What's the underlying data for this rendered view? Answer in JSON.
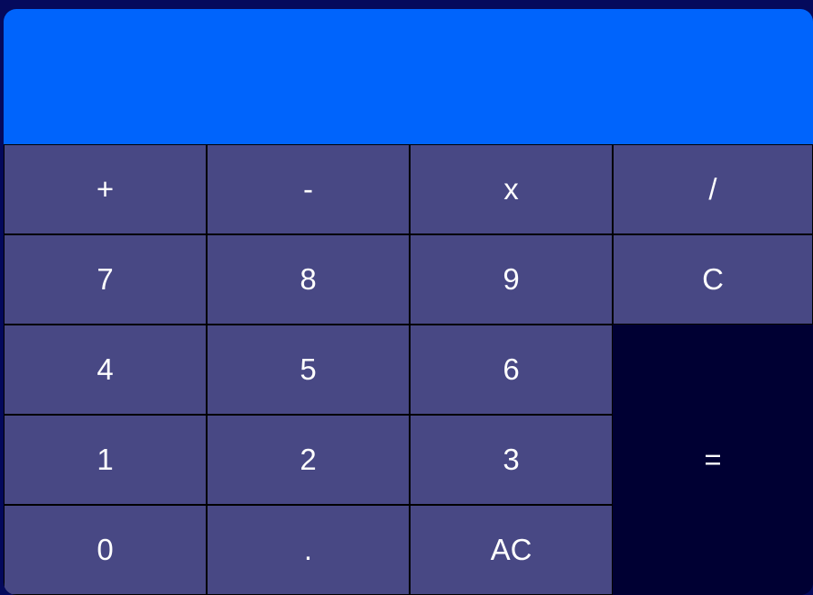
{
  "display": {
    "value": ""
  },
  "keys": {
    "plus": "+",
    "minus": "-",
    "multiply": "x",
    "divide": "/",
    "seven": "7",
    "eight": "8",
    "nine": "9",
    "clear": "C",
    "four": "4",
    "five": "5",
    "six": "6",
    "equals": "=",
    "one": "1",
    "two": "2",
    "three": "3",
    "zero": "0",
    "decimal": ".",
    "all_clear": "AC"
  },
  "colors": {
    "page_background": "#050a5c",
    "display_background": "#0064fc",
    "key_background": "#484884",
    "equals_background": "#000033",
    "key_text": "#ffffff"
  }
}
